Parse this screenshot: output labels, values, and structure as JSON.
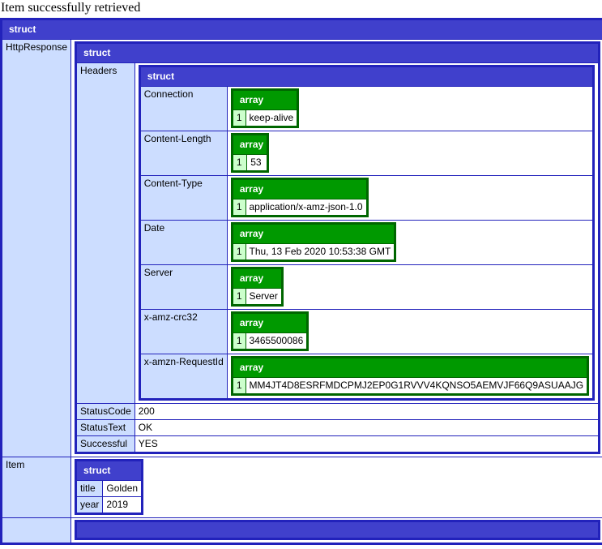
{
  "page": {
    "title": "Item successfully retrieved"
  },
  "labels": {
    "struct": "struct",
    "array": "array"
  },
  "root": {
    "type": "struct",
    "keys": {
      "http_response": "HttpResponse",
      "item": "Item"
    }
  },
  "http_response": {
    "type": "struct",
    "keys": {
      "headers": "Headers",
      "status_code": "StatusCode",
      "status_text": "StatusText",
      "successful": "Successful"
    },
    "status_code": "200",
    "status_text": "OK",
    "successful": "YES"
  },
  "headers": {
    "type": "struct",
    "rows": [
      {
        "key": "Connection",
        "index": "1",
        "value": "keep-alive"
      },
      {
        "key": "Content-Length",
        "index": "1",
        "value": "53"
      },
      {
        "key": "Content-Type",
        "index": "1",
        "value": "application/x-amz-json-1.0"
      },
      {
        "key": "Date",
        "index": "1",
        "value": "Thu, 13 Feb 2020 10:53:38 GMT"
      },
      {
        "key": "Server",
        "index": "1",
        "value": "Server"
      },
      {
        "key": "x-amz-crc32",
        "index": "1",
        "value": "3465500086"
      },
      {
        "key": "x-amzn-RequestId",
        "index": "1",
        "value": "MM4JT4D8ESRFMDCPMJ2EP0G1RVVV4KQNSO5AEMVJF66Q9ASUAAJG"
      }
    ]
  },
  "item": {
    "type": "struct",
    "rows": [
      {
        "key": "title",
        "value": "Golden"
      },
      {
        "key": "year",
        "value": "2019"
      }
    ]
  },
  "colors": {
    "struct_border": "#2222bb",
    "struct_header": "#4040cc",
    "struct_key": "#ccddff",
    "array_border": "#006600",
    "array_header": "#009900",
    "array_index": "#ccffcc",
    "value_bg": "#ffffff",
    "text": "#000000"
  }
}
